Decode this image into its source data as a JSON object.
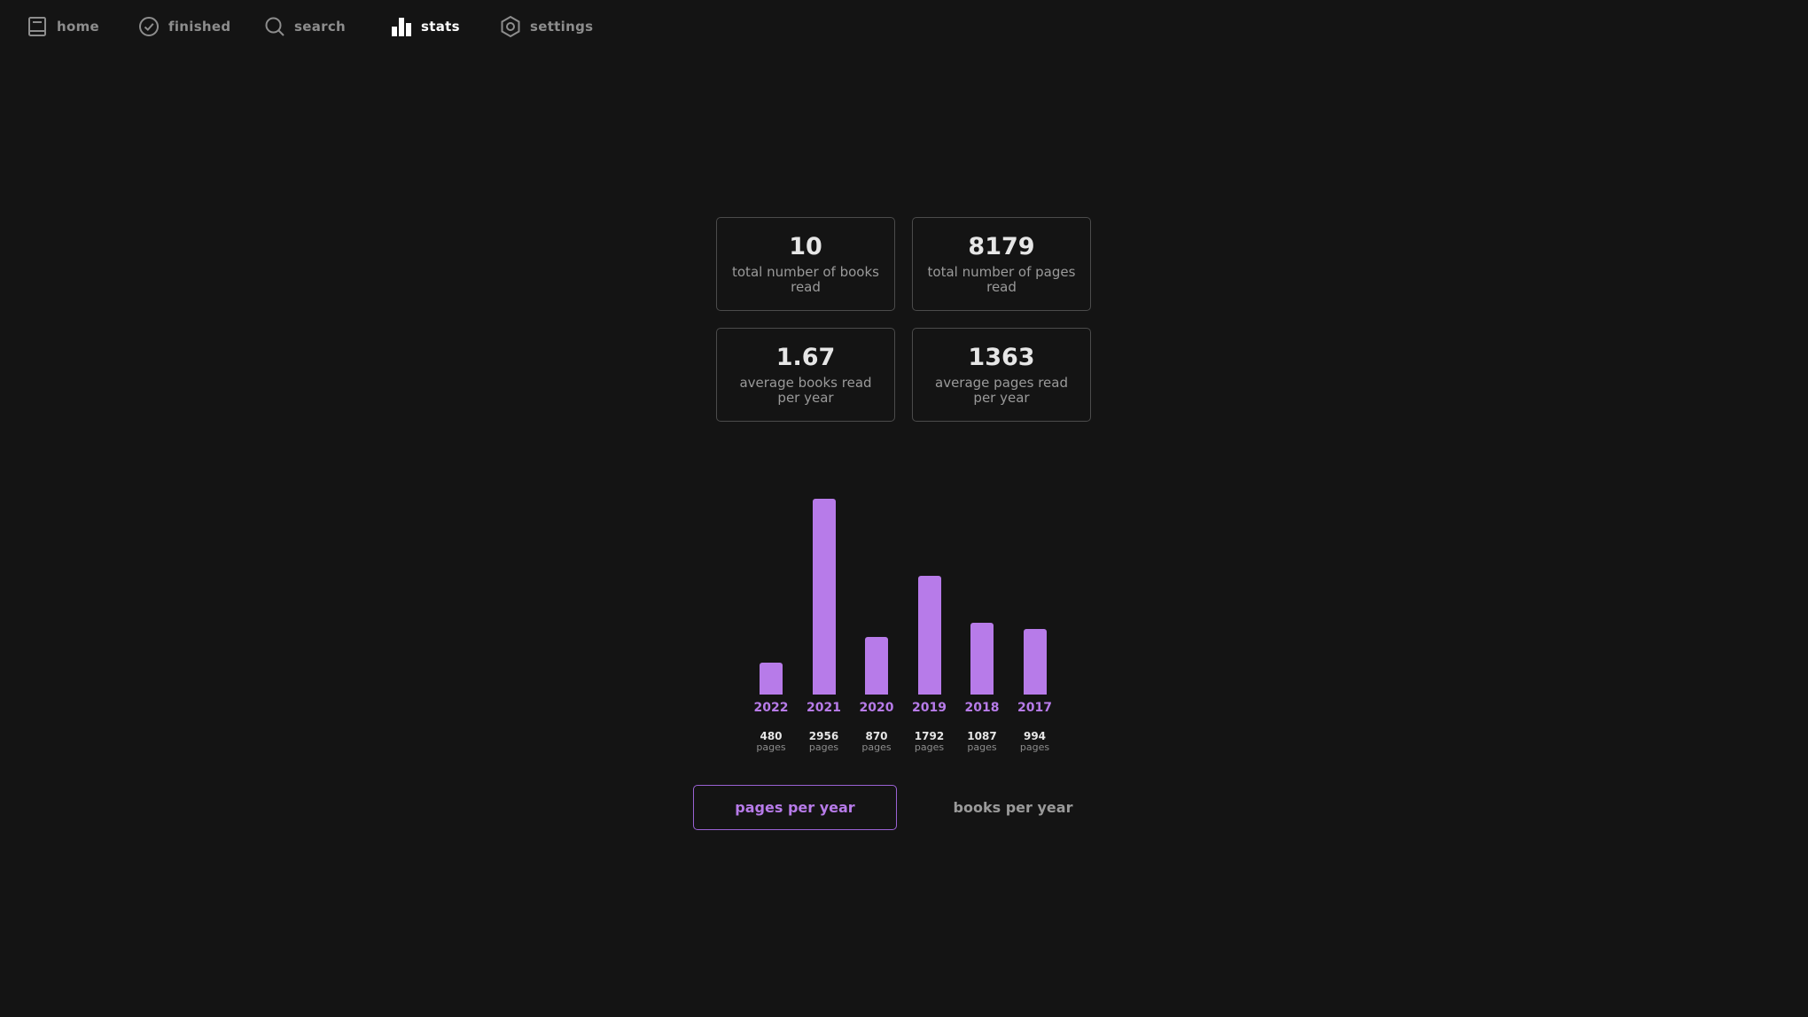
{
  "nav": {
    "items": [
      {
        "label": "home",
        "icon": "book-icon",
        "active": false
      },
      {
        "label": "finished",
        "icon": "check-circle-icon",
        "active": false
      },
      {
        "label": "search",
        "icon": "search-icon",
        "active": false
      },
      {
        "label": "stats",
        "icon": "bar-chart-icon",
        "active": true
      },
      {
        "label": "settings",
        "icon": "gear-icon",
        "active": false
      }
    ]
  },
  "stats": {
    "cards": [
      {
        "value": "10",
        "label": "total number of books read"
      },
      {
        "value": "8179",
        "label": "total number of pages read"
      },
      {
        "value": "1.67",
        "label": "average books read per year"
      },
      {
        "value": "1363",
        "label": "average pages read per year"
      }
    ]
  },
  "chart_data": {
    "type": "bar",
    "categories": [
      "2022",
      "2021",
      "2020",
      "2019",
      "2018",
      "2017"
    ],
    "values": [
      480,
      2956,
      870,
      1792,
      1087,
      994
    ],
    "value_labels": [
      "480",
      "2956",
      "870",
      "1792",
      "1087",
      "994"
    ],
    "unit_label": "pages",
    "title": "",
    "xlabel": "",
    "ylabel": "",
    "bar_color": "#b77be9"
  },
  "toggles": {
    "pages_label": "pages per year",
    "books_label": "books per year",
    "selected": "pages per year"
  },
  "colors": {
    "background": "#141414",
    "accent": "#b77be9",
    "muted_text": "#8d8d8d"
  }
}
